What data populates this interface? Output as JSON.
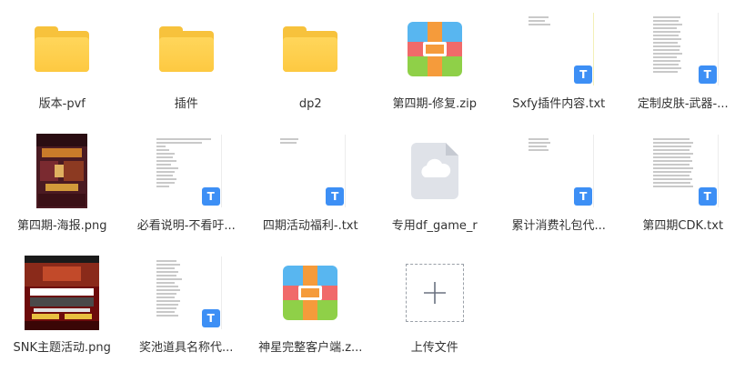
{
  "files": [
    {
      "name": "版本-pvf",
      "type": "folder"
    },
    {
      "name": "插件",
      "type": "folder"
    },
    {
      "name": "dp2",
      "type": "folder"
    },
    {
      "name": "第四期-修复.zip",
      "type": "zip"
    },
    {
      "name": "Sxfy插件内容.txt",
      "type": "txt",
      "badge": "T"
    },
    {
      "name": "定制皮肤-武器-...",
      "type": "txt",
      "badge": "T"
    },
    {
      "name": "第四期-海报.png",
      "type": "png"
    },
    {
      "name": "必看说明-不看吁...",
      "type": "txt",
      "badge": "T"
    },
    {
      "name": "四期活动福利-.txt",
      "type": "txt",
      "badge": "T"
    },
    {
      "name": "专用df_game_r",
      "type": "cloud"
    },
    {
      "name": "累计消费礼包代...",
      "type": "txt",
      "badge": "T"
    },
    {
      "name": "第四期CDK.txt",
      "type": "txt",
      "badge": "T"
    },
    {
      "name": "SNK主题活动.png",
      "type": "png"
    },
    {
      "name": "奖池道具名称代...",
      "type": "txt",
      "badge": "T"
    },
    {
      "name": "神星完整客户端.z...",
      "type": "zip"
    },
    {
      "name": "上传文件",
      "type": "upload"
    }
  ],
  "colors": {
    "folder": "#fdc941",
    "txt_badge": "#3d8ff5",
    "zip_blue": "#58b6f0",
    "zip_green": "#8fd048",
    "zip_red": "#f06a6a",
    "zip_orange": "#f59b3b"
  },
  "icons": {
    "folder": "folder-icon",
    "zip": "zip-archive-icon",
    "txt": "text-file-icon",
    "cloud": "cloud-file-icon",
    "upload": "plus-icon"
  }
}
